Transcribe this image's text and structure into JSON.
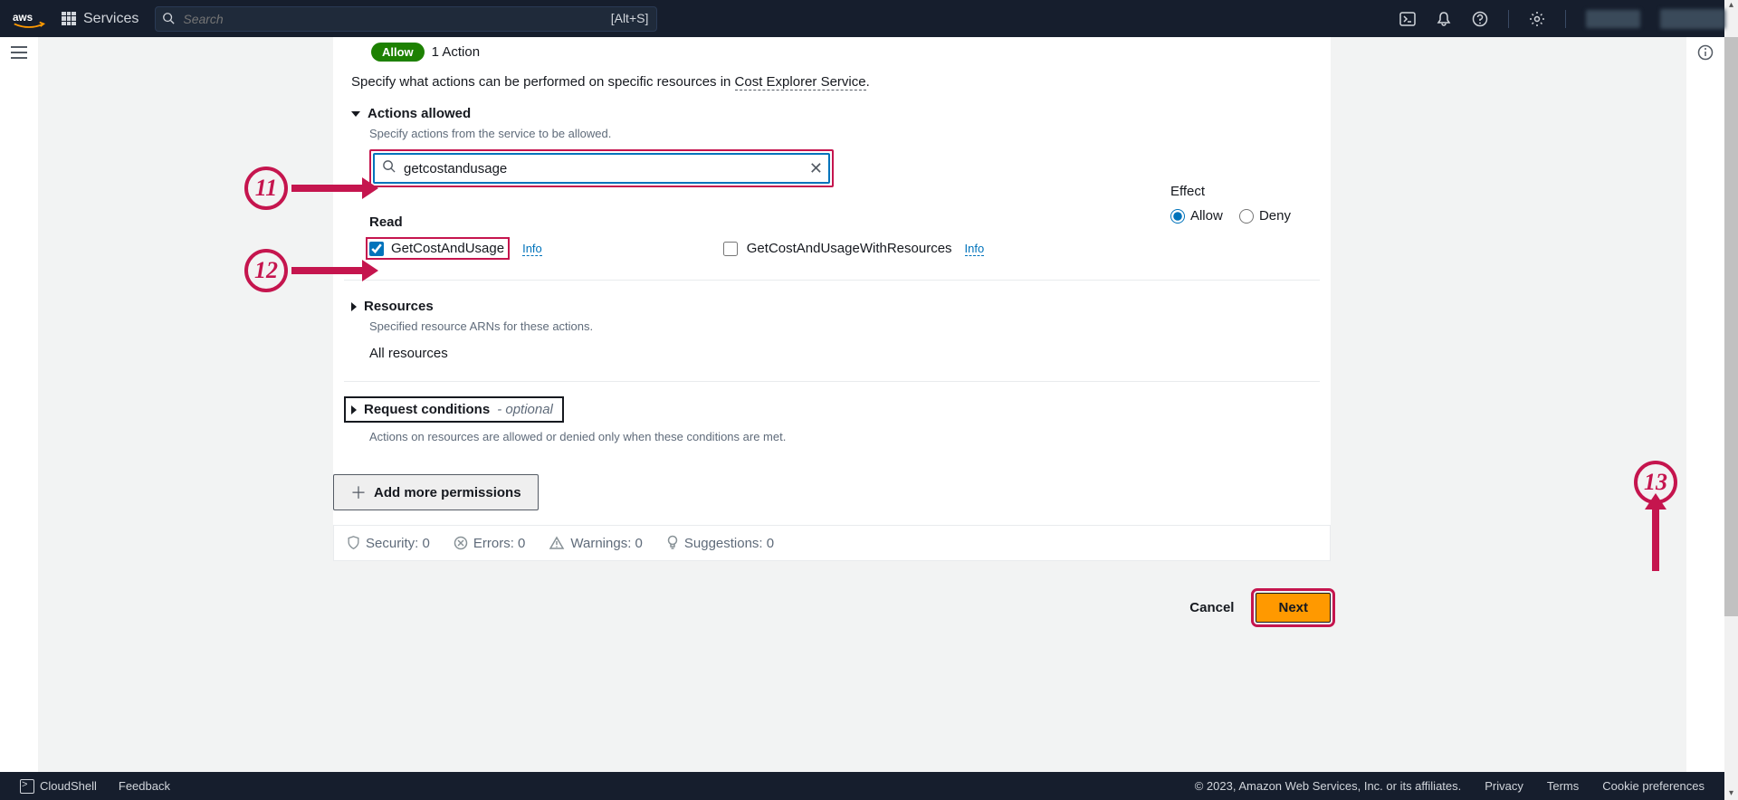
{
  "header": {
    "services": "Services",
    "search_placeholder": "Search",
    "search_kbd": "[Alt+S]"
  },
  "allow_badge": "Allow",
  "one_action": "1 Action",
  "specify_text_prefix": "Specify what actions can be performed on specific resources in ",
  "specify_link": "Cost Explorer Service",
  "specify_text_suffix": ".",
  "actions_allowed": {
    "heading": "Actions allowed",
    "desc": "Specify actions from the service to be allowed.",
    "search_value": "getcostandusage"
  },
  "effect": {
    "label": "Effect",
    "allow": "Allow",
    "deny": "Deny",
    "selected": "allow"
  },
  "read_heading": "Read",
  "actions": [
    {
      "name": "GetCostAndUsage",
      "checked": true,
      "info": "Info"
    },
    {
      "name": "GetCostAndUsageWithResources",
      "checked": false,
      "info": "Info"
    }
  ],
  "resources": {
    "heading": "Resources",
    "desc": "Specified resource ARNs for these actions.",
    "all": "All resources"
  },
  "request_conditions": {
    "label": "Request conditions",
    "optional": "- optional",
    "desc": "Actions on resources are allowed or denied only when these conditions are met."
  },
  "add_more": "Add more permissions",
  "status": {
    "security": "Security: 0",
    "errors": "Errors: 0",
    "warnings": "Warnings: 0",
    "suggestions": "Suggestions: 0"
  },
  "buttons": {
    "cancel": "Cancel",
    "next": "Next"
  },
  "callouts": {
    "c11": "11",
    "c12": "12",
    "c13": "13"
  },
  "footer": {
    "cloudshell": "CloudShell",
    "feedback": "Feedback",
    "copyright": "© 2023, Amazon Web Services, Inc. or its affiliates.",
    "privacy": "Privacy",
    "terms": "Terms",
    "cookies": "Cookie preferences"
  }
}
